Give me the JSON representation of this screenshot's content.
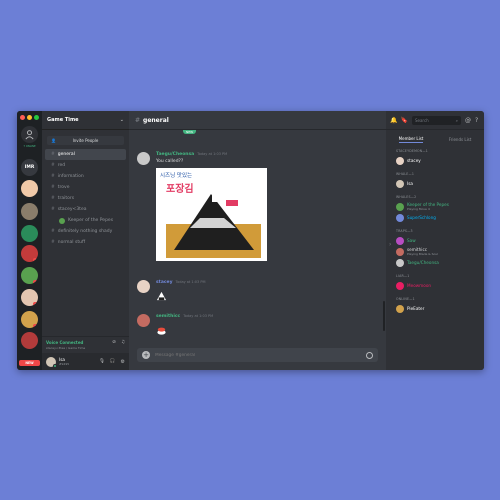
{
  "app": {
    "server_name": "Game Time",
    "online_label": "7 ONLINE"
  },
  "servers": {
    "text_server": "IMR",
    "new_label": "NEW"
  },
  "channels": {
    "invite_label": "Invite People",
    "items": [
      {
        "name": "general",
        "selected": true
      },
      {
        "name": "red"
      },
      {
        "name": "information"
      },
      {
        "name": "trove"
      },
      {
        "name": "traitors"
      },
      {
        "name": "stacey<3tea"
      },
      {
        "name": "Keeper of the Pepes",
        "voice_member": true
      },
      {
        "name": "definitely nothing shady"
      },
      {
        "name": "normal stuff"
      }
    ]
  },
  "voice": {
    "status": "Voice Connected",
    "detail": "stacey<3tea / Game Time"
  },
  "user": {
    "name": "Isa",
    "tag": "#9495"
  },
  "chat": {
    "channel": "general",
    "new_messages": "NEW",
    "messages": [
      {
        "author": "Taegu/Cheonsa",
        "time": "Today at 1:03 PM",
        "text": "You called??",
        "color": "#43b581"
      },
      {
        "author": "stacey",
        "time": "Today at 1:03 PM",
        "text": "",
        "color": "#7289da"
      },
      {
        "author": "semithicc",
        "time": "Today at 1:03 PM",
        "text": "",
        "color": "#43b581"
      }
    ],
    "image_text_top": "시즈닝 맛있는",
    "image_text_bottom": "포장김",
    "input_placeholder": "Message #general"
  },
  "member_panel": {
    "search_placeholder": "Search",
    "tabs": [
      "Member List",
      "Friends List"
    ],
    "groups": [
      {
        "label": "STACEYDEMON—1",
        "members": [
          {
            "name": "stacey",
            "color": "#ffffff"
          }
        ]
      },
      {
        "label": "WHALE—1",
        "members": [
          {
            "name": "Isa",
            "color": "#ffffff"
          }
        ]
      },
      {
        "label": "WHALES—2",
        "members": [
          {
            "name": "Keeper of the Pepes",
            "color": "#43b581",
            "sub": "Playing Move 4"
          },
          {
            "name": "SuperSchlong",
            "color": "#00b0f4"
          }
        ]
      },
      {
        "label": "TRAPS—3",
        "members": [
          {
            "name": "Saw",
            "color": "#43b581"
          },
          {
            "name": "semithicc",
            "color": "#dcddde",
            "sub": "Playing Blade & Soul"
          },
          {
            "name": "Taegu/Cheonsa",
            "color": "#43b581"
          }
        ]
      },
      {
        "label": "LIAR—1",
        "members": [
          {
            "name": "Meowmoon",
            "color": "#e91e63"
          }
        ]
      },
      {
        "label": "ONLINE—1",
        "members": [
          {
            "name": "PieEater",
            "color": "#ffffff"
          }
        ]
      }
    ]
  },
  "colors": {
    "background": "#6c7fd6",
    "accent": "#7289da",
    "online": "#43b581"
  }
}
